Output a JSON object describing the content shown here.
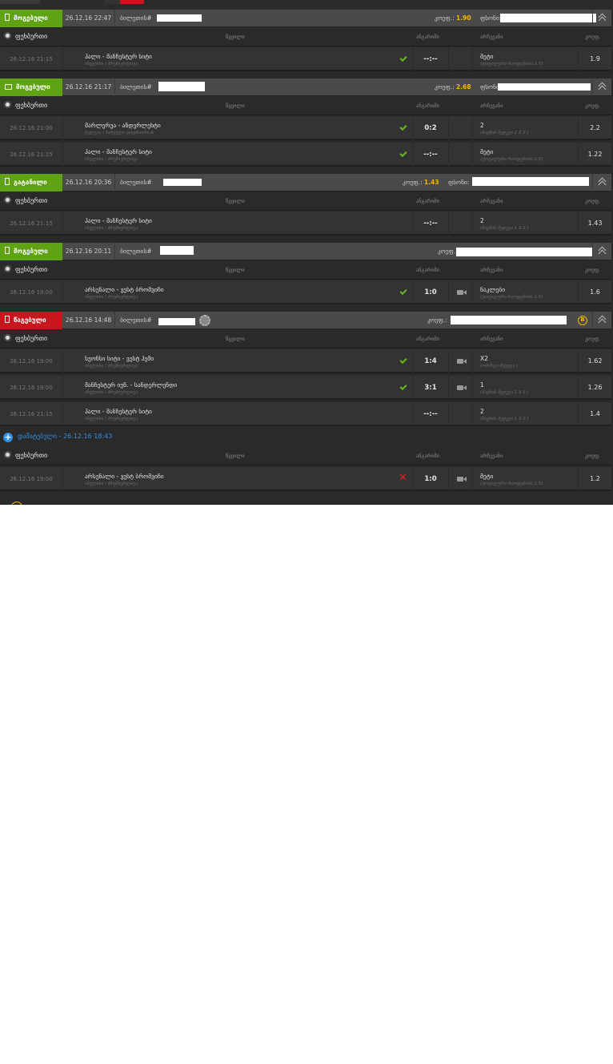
{
  "labels": {
    "sport": "ფეხბურთი",
    "col_event": "წყვილი",
    "col_result": "ანგარიში",
    "col_pick": "არჩევანი",
    "col_coef": "კოეფ.",
    "ticket": "ბილეთის#",
    "coef": "კოეფ.:",
    "stake": "ფსონი:"
  },
  "bets": [
    {
      "status": "მოგებული",
      "status_color": "#5fa315",
      "device_icon": "phone-icon",
      "date": "26.12.16 22:47",
      "coef_value": "1.90",
      "rows": [
        {
          "time": "26.12.16 21:15",
          "event": "ჰალი - მანჩესტერ სიტი",
          "sub": "ინგლისი / პრემიერლიგა",
          "result": "check",
          "score": "--:--",
          "camera": false,
          "pick": "მეტი",
          "pick_sub": "(ტოტალური რაოდენობა 2.5)",
          "coef": "1.9"
        }
      ]
    },
    {
      "status": "მოგებული",
      "status_color": "#5fa315",
      "device_icon": "desktop-icon",
      "date": "26.12.16 21:17",
      "coef_value": "2.68",
      "rows": [
        {
          "time": "26.12.16 21:00",
          "event": "მარლერუა - ანდერლეხტი",
          "sub": "ბელგია / პირველი დივიზიონი A",
          "result": "check",
          "score": "0:2",
          "camera": false,
          "pick": "2",
          "pick_sub": "(მატჩის შედეგი 1 X 2 )",
          "coef": "2.2"
        },
        {
          "time": "26.12.16 21:15",
          "event": "ჰალი - მანჩესტერ სიტი",
          "sub": "ინგლისი / პრემიერლიგა",
          "result": "check",
          "score": "--:--",
          "camera": false,
          "pick": "მეტი",
          "pick_sub": "(ტოტალური რაოდენობა 2.5)",
          "coef": "1.22"
        }
      ]
    },
    {
      "status": "გატანილი",
      "status_color": "#5fa315",
      "device_icon": "phone-icon",
      "date": "26.12.16 20:36",
      "coef_value": "1.43",
      "rows": [
        {
          "time": "26.12.16 21:15",
          "event": "ჰალი - მანჩესტერ სიტი",
          "sub": "ინგლისი / პრემიერლიგა",
          "result": "none",
          "score": "--:--",
          "camera": false,
          "pick": "2",
          "pick_sub": "(მატჩის შედეგი 1 X 2 )",
          "coef": "1.43"
        }
      ]
    },
    {
      "status": "მოგებული",
      "status_color": "#5fa315",
      "device_icon": "phone-icon",
      "date": "26.12.16 20:11",
      "coef_value": "",
      "rows": [
        {
          "time": "26.12.16 19:00",
          "event": "არსენალი - ვესტ ბრომვიჩი",
          "sub": "ინგლისი / პრემიერლიგა",
          "result": "check",
          "score": "1:0",
          "camera": true,
          "pick": "ნაკლები",
          "pick_sub": "(ტოტალური რაოდენობა 1.5)",
          "coef": "1.6"
        }
      ]
    },
    {
      "status": "წაგებული",
      "status_color": "#c8161d",
      "device_icon": "phone-icon",
      "date": "26.12.16 14:48",
      "coef_value": "",
      "bonus_label": "B",
      "rows": [
        {
          "time": "26.12.16 19:00",
          "event": "სუონსი სიტი - ვესტ ჰემი",
          "sub": "ინგლისი / პრემიერლიგა",
          "result": "check",
          "score": "1:4",
          "camera": true,
          "pick": "X2",
          "pick_sub": "(ორმაგი შედეგი )",
          "coef": "1.62"
        },
        {
          "time": "26.12.16 19:00",
          "event": "მანჩესტერ იუნ. - სანდერლენდი",
          "sub": "ინგლისი / პრემიერლიგა",
          "result": "check",
          "score": "3:1",
          "camera": true,
          "pick": "1",
          "pick_sub": "(მატჩის შედეგი 1 X 2 )",
          "coef": "1.26"
        },
        {
          "time": "26.12.16 21:15",
          "event": "ჰალი - მანჩესტერ სიტი",
          "sub": "ინგლისი / პრემიერლიგა",
          "result": "none",
          "score": "--:--",
          "camera": false,
          "pick": "2",
          "pick_sub": "(მატჩის შედეგი 1 X 2 )",
          "coef": "1.4"
        }
      ],
      "system_line": "დამატებული - 26.12.16 18:43",
      "extra_rows": [
        {
          "time": "26.12.16 19:00",
          "event": "არსენალი - ვესტ ბრომვიჩი",
          "sub": "ინგლისი / პრემიერლიგა",
          "result": "cross",
          "score": "1:0",
          "camera": true,
          "pick": "მეტი",
          "pick_sub": "(ტოტალური რაოდენობა 2.5)",
          "coef": "1.2"
        }
      ]
    }
  ]
}
